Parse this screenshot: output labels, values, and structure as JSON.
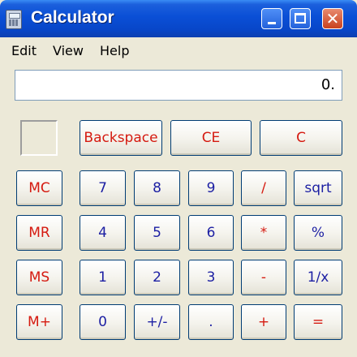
{
  "window": {
    "title": "Calculator",
    "close_glyph": "✕"
  },
  "menu": {
    "items": [
      "Edit",
      "View",
      "Help"
    ]
  },
  "display": {
    "value": "0."
  },
  "keys": {
    "backspace": "Backspace",
    "ce": "CE",
    "c": "C",
    "mc": "MC",
    "mr": "MR",
    "ms": "MS",
    "mplus": "M+",
    "n7": "7",
    "n8": "8",
    "n9": "9",
    "div": "/",
    "sqrt": "sqrt",
    "n4": "4",
    "n5": "5",
    "n6": "6",
    "mul": "*",
    "pct": "%",
    "n1": "1",
    "n2": "2",
    "n3": "3",
    "sub": "-",
    "recip": "1/x",
    "n0": "0",
    "sign": "+/-",
    "dot": ".",
    "add": "+",
    "eq": "="
  },
  "colors": {
    "operator": "#d51a10",
    "digit": "#1c1fa3",
    "title_bar": "#0a4fd6"
  }
}
